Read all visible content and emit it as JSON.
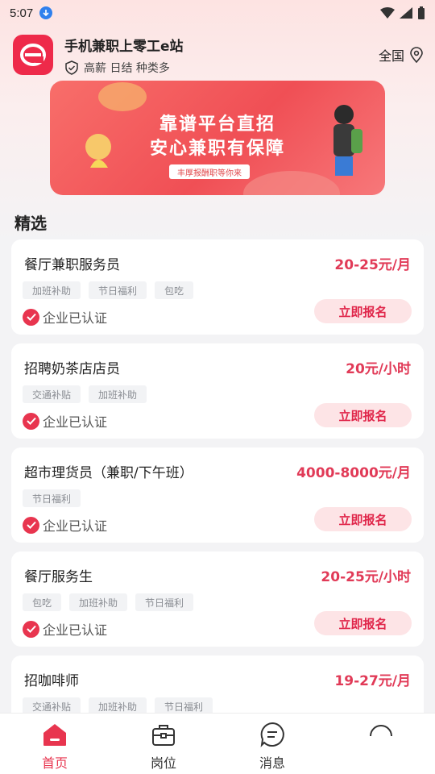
{
  "status_bar": {
    "time": "5:07"
  },
  "header": {
    "app_name": "手机兼职上零工e站",
    "subtitle": "高薪 日结 种类多",
    "region": "全国"
  },
  "banner": {
    "line1": "靠谱平台直招",
    "line2": "安心兼职有保障",
    "tag": "丰厚报酬职等你来"
  },
  "section_title": "精选",
  "verified_label": "企业已认证",
  "apply_label": "立即报名",
  "jobs": [
    {
      "title": "餐厅兼职服务员",
      "salary": "20-25元/月",
      "tags": [
        "加班补助",
        "节日福利",
        "包吃"
      ]
    },
    {
      "title": "招聘奶茶店店员",
      "salary": "20元/小时",
      "tags": [
        "交通补贴",
        "加班补助"
      ]
    },
    {
      "title": "超市理货员（兼职/下午班）",
      "salary": "4000-8000元/月",
      "tags": [
        "节日福利"
      ]
    },
    {
      "title": "餐厅服务生",
      "salary": "20-25元/小时",
      "tags": [
        "包吃",
        "加班补助",
        "节日福利"
      ]
    },
    {
      "title": "招咖啡师",
      "salary": "19-27元/月",
      "tags": [
        "交通补贴",
        "加班补助",
        "节日福利"
      ]
    }
  ],
  "nav": [
    {
      "label": "首页",
      "icon": "home-icon",
      "active": true
    },
    {
      "label": "岗位",
      "icon": "briefcase-icon",
      "active": false
    },
    {
      "label": "消息",
      "icon": "message-icon",
      "active": false
    },
    {
      "label": "",
      "icon": "profile-icon",
      "active": false
    }
  ],
  "colors": {
    "accent": "#e8354f",
    "salary": "#e13a57",
    "apply_bg": "#fde4e6",
    "banner": "#f04f55"
  }
}
